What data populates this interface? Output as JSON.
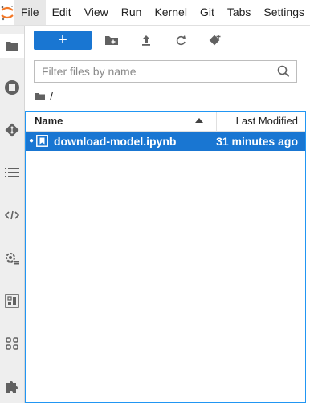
{
  "menubar": {
    "logo": "jupyter-logo",
    "items": [
      "File",
      "Edit",
      "View",
      "Run",
      "Kernel",
      "Git",
      "Tabs",
      "Settings"
    ]
  },
  "activity_bar": {
    "icons": [
      "folder-icon",
      "running-stop-icon",
      "git-icon",
      "table-of-contents-icon",
      "code-snippets-icon",
      "property-inspector-icon",
      "dashboard-icon",
      "extensions-icon",
      "puzzle-icon"
    ]
  },
  "toolbar": {
    "new_label": "+",
    "buttons": [
      "new-folder-icon",
      "upload-icon",
      "refresh-icon",
      "git-clone-icon"
    ]
  },
  "filter": {
    "placeholder": "Filter files by name",
    "value": ""
  },
  "breadcrumb": {
    "root": "/"
  },
  "listing": {
    "columns": {
      "name": "Name",
      "modified": "Last Modified"
    },
    "sort": "name-ascending",
    "rows": [
      {
        "name": "download-model.ipynb",
        "modified": "31 minutes ago",
        "selected": true,
        "running": true
      }
    ]
  },
  "colors": {
    "accent": "#1976d2",
    "focus_border": "#2196f3",
    "activity_bg": "#eeeeee",
    "logo_orange": "#f37726"
  }
}
